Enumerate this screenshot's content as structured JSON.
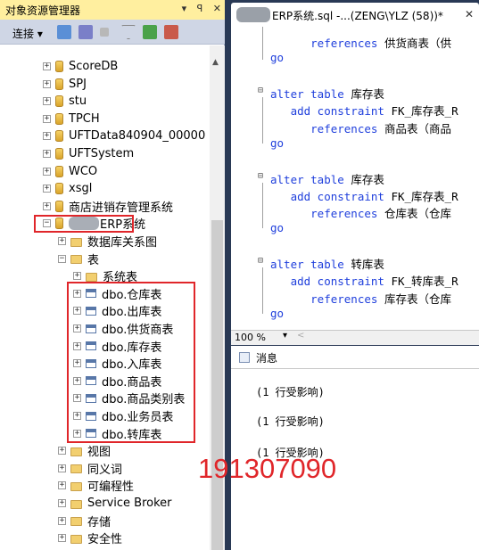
{
  "object_explorer": {
    "title": "对象资源管理器",
    "title_buttons": [
      "▾",
      "ꟼ",
      "✕"
    ],
    "toolbar": {
      "connect_label": "连接 ▾"
    },
    "tree": [
      {
        "label": "ScoreDB",
        "kind": "db",
        "level": 0
      },
      {
        "label": "SPJ",
        "kind": "db",
        "level": 0
      },
      {
        "label": "stu",
        "kind": "db",
        "level": 0
      },
      {
        "label": "TPCH",
        "kind": "db",
        "level": 0
      },
      {
        "label": "UFTData840904_00000",
        "kind": "db",
        "level": 0
      },
      {
        "label": "UFTSystem",
        "kind": "db",
        "level": 0
      },
      {
        "label": "WCO",
        "kind": "db",
        "level": 0
      },
      {
        "label": "xsgl",
        "kind": "db",
        "level": 0
      },
      {
        "label": "商店进销存管理系统",
        "kind": "db",
        "level": 0
      },
      {
        "label": "ERP系统",
        "kind": "db",
        "level": 0,
        "expanded": true
      },
      {
        "label": "数据库关系图",
        "kind": "folder",
        "level": 1
      },
      {
        "label": "表",
        "kind": "folder",
        "level": 1,
        "expanded": true
      },
      {
        "label": "系统表",
        "kind": "folder",
        "level": 2
      },
      {
        "label": "dbo.仓库表",
        "kind": "table",
        "level": 2
      },
      {
        "label": "dbo.出库表",
        "kind": "table",
        "level": 2
      },
      {
        "label": "dbo.供货商表",
        "kind": "table",
        "level": 2
      },
      {
        "label": "dbo.库存表",
        "kind": "table",
        "level": 2
      },
      {
        "label": "dbo.入库表",
        "kind": "table",
        "level": 2
      },
      {
        "label": "dbo.商品表",
        "kind": "table",
        "level": 2
      },
      {
        "label": "dbo.商品类别表",
        "kind": "table",
        "level": 2
      },
      {
        "label": "dbo.业务员表",
        "kind": "table",
        "level": 2
      },
      {
        "label": "dbo.转库表",
        "kind": "table",
        "level": 2
      },
      {
        "label": "视图",
        "kind": "folder",
        "level": 1
      },
      {
        "label": "同义词",
        "kind": "folder",
        "level": 1
      },
      {
        "label": "可编程性",
        "kind": "folder",
        "level": 1
      },
      {
        "label": "Service Broker",
        "kind": "folder",
        "level": 1
      },
      {
        "label": "存储",
        "kind": "folder",
        "level": 1
      },
      {
        "label": "安全性",
        "kind": "folder",
        "level": 1
      }
    ]
  },
  "editor": {
    "tab_title": "ERP系统.sql -...(ZENG\\YLZ (58))*",
    "tab_close": "✕",
    "code_lines": [
      {
        "indent": "      ",
        "kw": "references",
        "rest": " 供货商表（供"
      },
      {
        "indent": "",
        "kw": "go",
        "rest": ""
      },
      {
        "indent": "",
        "kw": "",
        "rest": ""
      },
      {
        "indent": "",
        "kw": "alter table",
        "rest": " 库存表"
      },
      {
        "indent": "   ",
        "kw": "add constraint",
        "rest": " FK_库存表_R"
      },
      {
        "indent": "      ",
        "kw": "references",
        "rest": " 商品表（商品"
      },
      {
        "indent": "",
        "kw": "go",
        "rest": ""
      },
      {
        "indent": "",
        "kw": "",
        "rest": ""
      },
      {
        "indent": "",
        "kw": "alter table",
        "rest": " 库存表"
      },
      {
        "indent": "   ",
        "kw": "add constraint",
        "rest": " FK_库存表_R"
      },
      {
        "indent": "      ",
        "kw": "references",
        "rest": " 仓库表（仓库"
      },
      {
        "indent": "",
        "kw": "go",
        "rest": ""
      },
      {
        "indent": "",
        "kw": "",
        "rest": ""
      },
      {
        "indent": "",
        "kw": "alter table",
        "rest": " 转库表"
      },
      {
        "indent": "   ",
        "kw": "add constraint",
        "rest": " FK_转库表_R"
      },
      {
        "indent": "      ",
        "kw": "references",
        "rest": " 库存表（仓库"
      },
      {
        "indent": "",
        "kw": "go",
        "rest": ""
      }
    ],
    "zoom": "100 %",
    "messages_tab": "消息",
    "messages": [
      "(1 行受影响)",
      "(1 行受影响)",
      "(1 行受影响)"
    ]
  },
  "watermark": "191307090",
  "colors": {
    "highlight_box": "#e0262a",
    "keyword": "#1f3fdc",
    "title_bar": "#ffef9f",
    "frame": "#293955"
  }
}
